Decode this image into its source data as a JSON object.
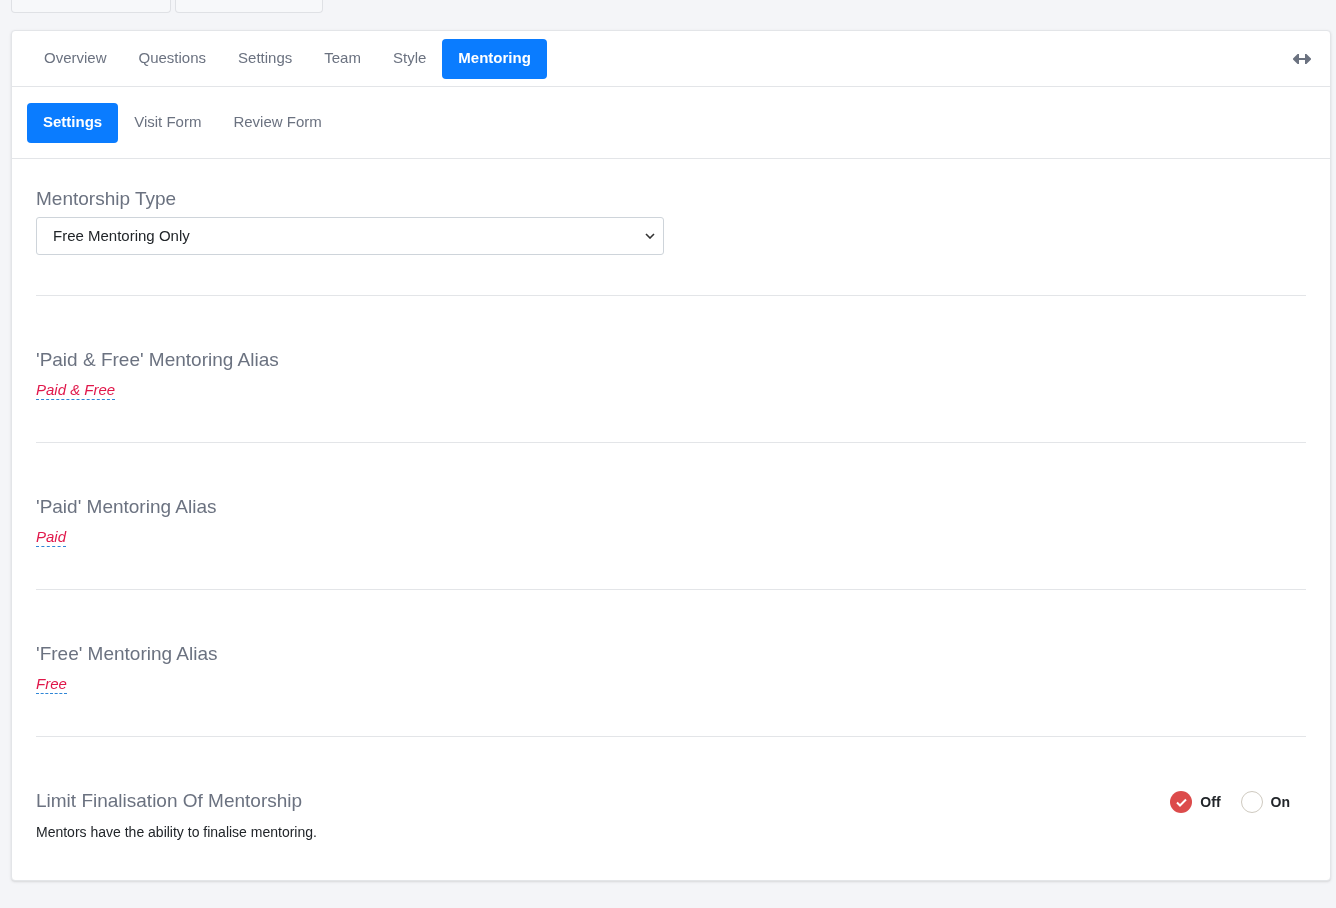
{
  "tabs": [
    {
      "label": "Overview",
      "selected": false
    },
    {
      "label": "Questions",
      "selected": false
    },
    {
      "label": "Settings",
      "selected": false
    },
    {
      "label": "Team",
      "selected": false
    },
    {
      "label": "Style",
      "selected": false
    },
    {
      "label": "Mentoring",
      "selected": true
    }
  ],
  "subtabs": [
    {
      "label": "Settings",
      "selected": true
    },
    {
      "label": "Visit Form",
      "selected": false
    },
    {
      "label": "Review Form",
      "selected": false
    }
  ],
  "sections": [
    {
      "kind": "select",
      "title": "Mentorship Type",
      "value": "Free Mentoring Only"
    },
    {
      "kind": "alias",
      "title": "'Paid & Free' Mentoring Alias",
      "value": "Paid & Free"
    },
    {
      "kind": "alias",
      "title": "'Paid' Mentoring Alias",
      "value": "Paid"
    },
    {
      "kind": "alias",
      "title": "'Free' Mentoring Alias",
      "value": "Free"
    },
    {
      "kind": "radio",
      "title": "Limit Finalisation Of Mentorship",
      "description": "Mentors have the ability to finalise mentoring.",
      "options": [
        {
          "label": "Off",
          "selected": true
        },
        {
          "label": "On",
          "selected": false
        }
      ]
    }
  ]
}
